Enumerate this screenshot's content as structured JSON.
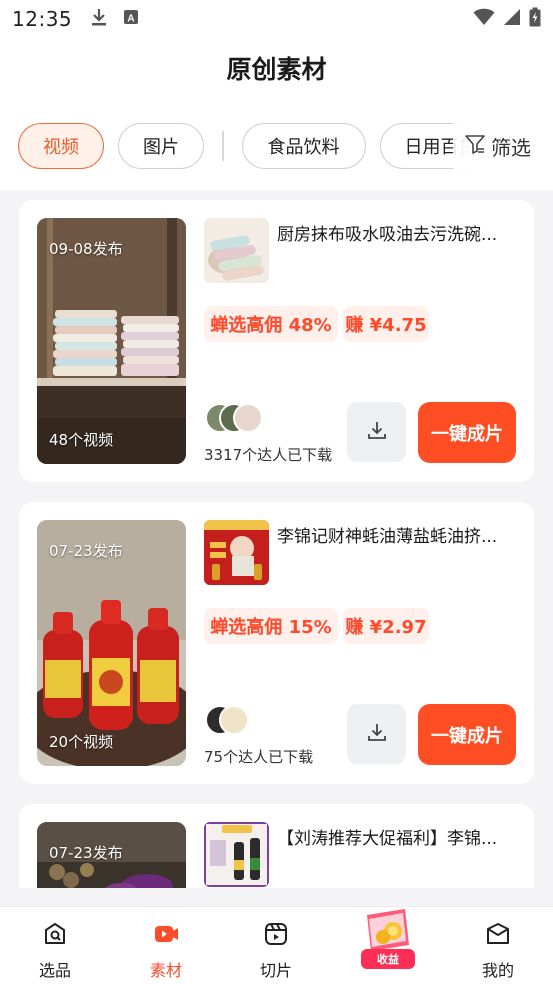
{
  "status_bar": {
    "time": "12:35"
  },
  "header": {
    "title": "原创素材"
  },
  "tabs": {
    "video": "视频",
    "image": "图片",
    "food": "食品饮料",
    "daily": "日用百货",
    "filter": "筛选"
  },
  "cards": [
    {
      "date": "09-08发布",
      "video_count": "48个视频",
      "title": "厨房抹布吸水吸油去污洗碗...",
      "rate_tag": "蝉选高佣 48%",
      "earn_tag": "赚 ¥4.75",
      "downloads": "3317个达人已下载",
      "make_label": "一键成片"
    },
    {
      "date": "07-23发布",
      "video_count": "20个视频",
      "title": "李锦记财神蚝油薄盐蚝油挤...",
      "rate_tag": "蝉选高佣 15%",
      "earn_tag": "赚 ¥2.97",
      "downloads": "75个达人已下载",
      "make_label": "一键成片"
    },
    {
      "date": "07-23发布",
      "title": "【刘涛推荐大促福利】李锦..."
    }
  ],
  "bottom_nav": {
    "select": "选品",
    "material": "素材",
    "clip": "切片",
    "earnings": "收益",
    "mine": "我的"
  },
  "colors": {
    "accent": "#ff4e24",
    "accent_tag_bg": "#fff0ec",
    "earn_badge": "#ff2e55"
  }
}
